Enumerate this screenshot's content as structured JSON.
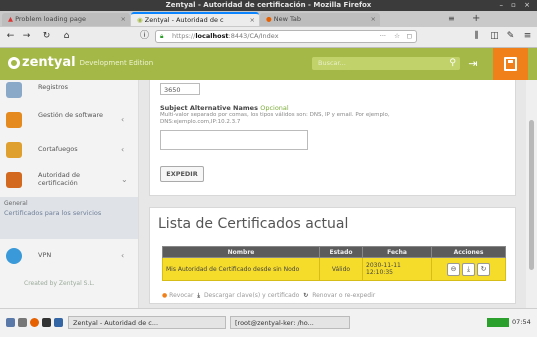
{
  "window": {
    "title": "Zentyal - Autoridad de certificación - Mozilla Firefox"
  },
  "tabs": [
    {
      "label": "Problem loading page"
    },
    {
      "label": "Zentyal - Autoridad de c"
    },
    {
      "label": "New Tab"
    }
  ],
  "navbar": {
    "url_host": "localhost",
    "url_path": ":8443/CA/Index",
    "url_scheme": "https://"
  },
  "header": {
    "logo_word": "zentyal",
    "edition": "Development Edition",
    "search_placeholder": "Buscar..."
  },
  "sidebar": {
    "items": [
      {
        "label": "Registros",
        "icon": "list-icon",
        "color": "#8aa8c8"
      },
      {
        "label": "Gestión de software",
        "icon": "package-icon",
        "color": "#e58a1f"
      },
      {
        "label": "Cortafuegos",
        "icon": "firewall-icon",
        "color": "#e0a030"
      },
      {
        "label": "Autoridad de certificación",
        "icon": "certificate-icon",
        "color": "#d2691e"
      }
    ],
    "section_head": "General",
    "section_sub": "Certificados para los servicios",
    "vpn": {
      "label": "VPN",
      "icon": "vpn-icon",
      "color": "#3a9ad9"
    },
    "copyright": "Created by Zentyal S.L."
  },
  "form": {
    "days_value": "3650",
    "field_label": "Subject Alternative Names",
    "field_optional": "Opcional",
    "field_help": "Multi-valor separado por comas, los tipos válidos son: DNS, IP y email. Por ejemplo, DNS:ejemplo.com,IP:10.2.3.7",
    "field_value": "",
    "submit_label": "EXPEDIR"
  },
  "certs": {
    "title": "Lista de Certificados actual",
    "columns": [
      "Nombre",
      "Estado",
      "Fecha",
      "Acciones"
    ],
    "rows": [
      {
        "name": "Mis Autoridad de Certificado desde sin Nodo",
        "status": "Válido",
        "date": "2030-11-11 12:10:35"
      }
    ],
    "legend": {
      "revoke": "Revocar",
      "download": "Descargar clave(s) y certificado",
      "renew": "Renovar o re-expedir"
    }
  },
  "taskbar": {
    "tasks": [
      "Zentyal - Autoridad de c...",
      "[root@zentyal-ker: /ho..."
    ],
    "clock": "07:54"
  }
}
